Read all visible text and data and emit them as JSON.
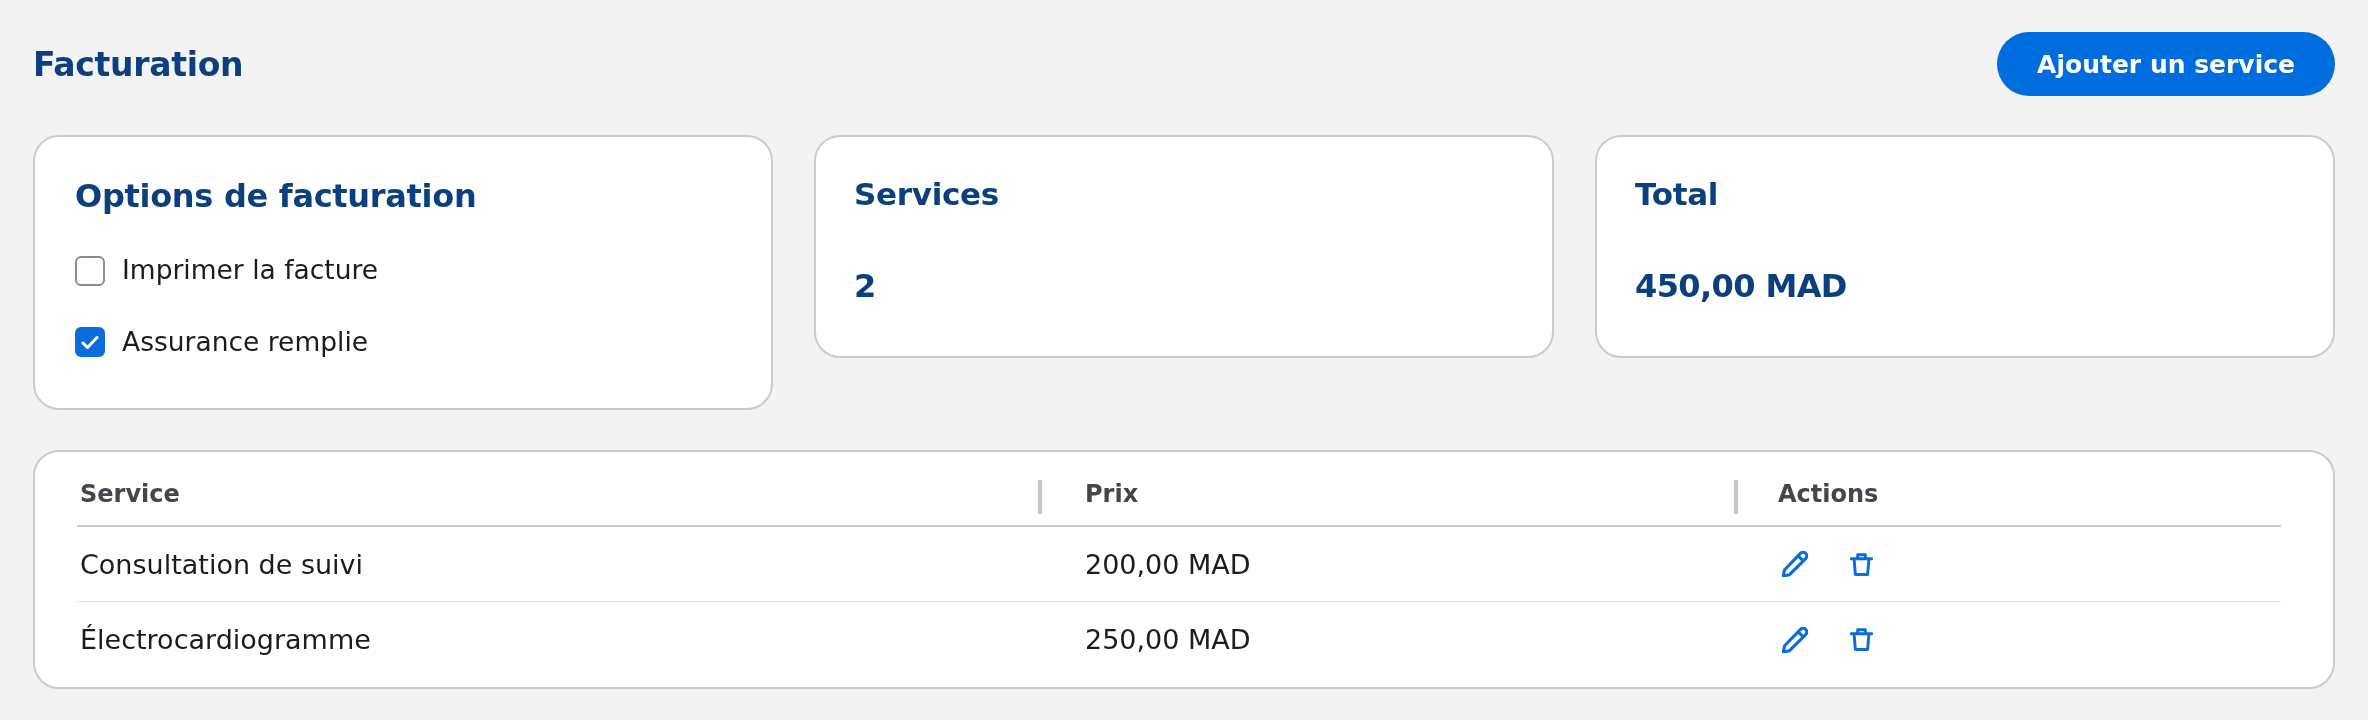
{
  "header": {
    "title": "Facturation",
    "add_button": "Ajouter un service"
  },
  "options_card": {
    "title": "Options de facturation",
    "options": [
      {
        "label": "Imprimer la facture",
        "checked": false
      },
      {
        "label": "Assurance remplie",
        "checked": true
      }
    ]
  },
  "stat_cards": [
    {
      "title": "Services",
      "value": "2"
    },
    {
      "title": "Total",
      "value": "450,00 MAD"
    }
  ],
  "table": {
    "columns": [
      "Service",
      "Prix",
      "Actions"
    ],
    "rows": [
      {
        "service": "Consultation de suivi",
        "price": "200,00 MAD"
      },
      {
        "service": "Électrocardiogramme",
        "price": "250,00 MAD"
      }
    ]
  }
}
